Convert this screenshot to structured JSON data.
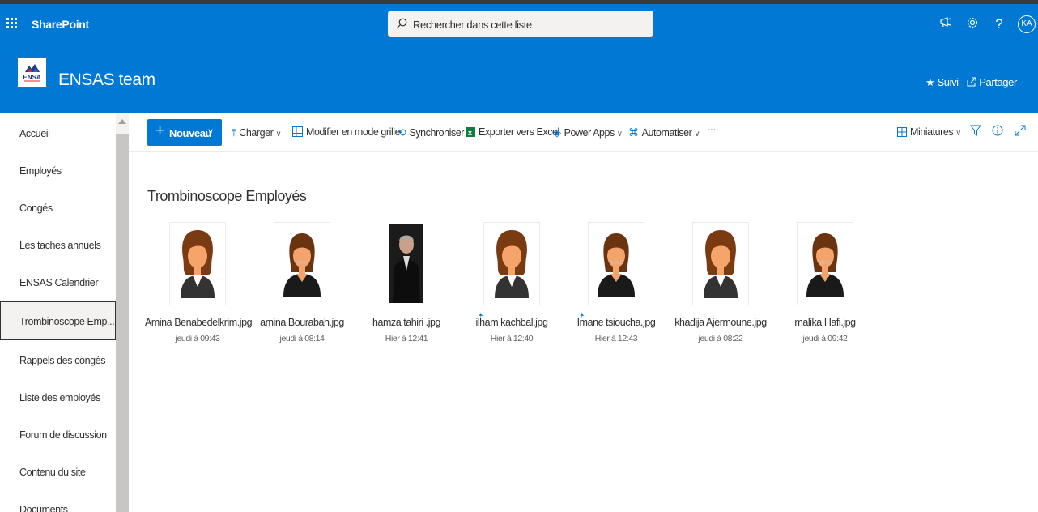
{
  "suite": {
    "app_name": "SharePoint",
    "search_placeholder": "Rechercher dans cette liste",
    "avatar_initials": "KA"
  },
  "site": {
    "title": "ENSAS team",
    "logo_text": "ENSA",
    "follow_label": "Suivi",
    "share_label": "Partager"
  },
  "nav": {
    "items": [
      {
        "label": "Accueil"
      },
      {
        "label": "Employés"
      },
      {
        "label": "Congés"
      },
      {
        "label": "Les taches annuels"
      },
      {
        "label": "ENSAS Calendrier"
      },
      {
        "label": "Trombinoscope Emp...",
        "selected": true
      },
      {
        "label": "Rappels des congés"
      },
      {
        "label": "Liste des employés"
      },
      {
        "label": "Forum de discussion"
      },
      {
        "label": "Contenu du site"
      },
      {
        "label": "Documents"
      }
    ]
  },
  "commands": {
    "new_label": "Nouveau",
    "upload_label": "Charger",
    "grid_edit_label": "Modifier en mode grille",
    "sync_label": "Synchroniser",
    "export_label": "Exporter vers Excel",
    "powerapps_label": "Power Apps",
    "automate_label": "Automatiser",
    "more_label": "···",
    "view_label": "Miniatures"
  },
  "library": {
    "title": "Trombinoscope Employés",
    "files": [
      {
        "name": "Amina Benabedelkrim.jpg",
        "date": "jeudi à 09:43",
        "thumb": "avatar-female",
        "is_new": false
      },
      {
        "name": "amina Bourabah.jpg",
        "date": "jeudi à 08:14",
        "thumb": "avatar-female-stock",
        "is_new": false
      },
      {
        "name": "hamza tahiri .jpg",
        "date": "Hier à 12:41",
        "thumb": "photo-portrait",
        "is_new": false
      },
      {
        "name": "ilham kachbal.jpg",
        "date": "Hier à 12:40",
        "thumb": "avatar-female",
        "is_new": true
      },
      {
        "name": "Imane tsioucha.jpg",
        "date": "Hier à 12:43",
        "thumb": "avatar-female-stock",
        "is_new": true
      },
      {
        "name": "khadija Ajermoune.jpg",
        "date": "jeudi à 08:22",
        "thumb": "avatar-female",
        "is_new": false
      },
      {
        "name": "malika Hafi.jpg",
        "date": "jeudi à 09:42",
        "thumb": "avatar-female-stock",
        "is_new": false
      }
    ]
  },
  "colors": {
    "brand": "#0078d4",
    "suite_dark": "#3b3a39",
    "text": "#323130"
  }
}
